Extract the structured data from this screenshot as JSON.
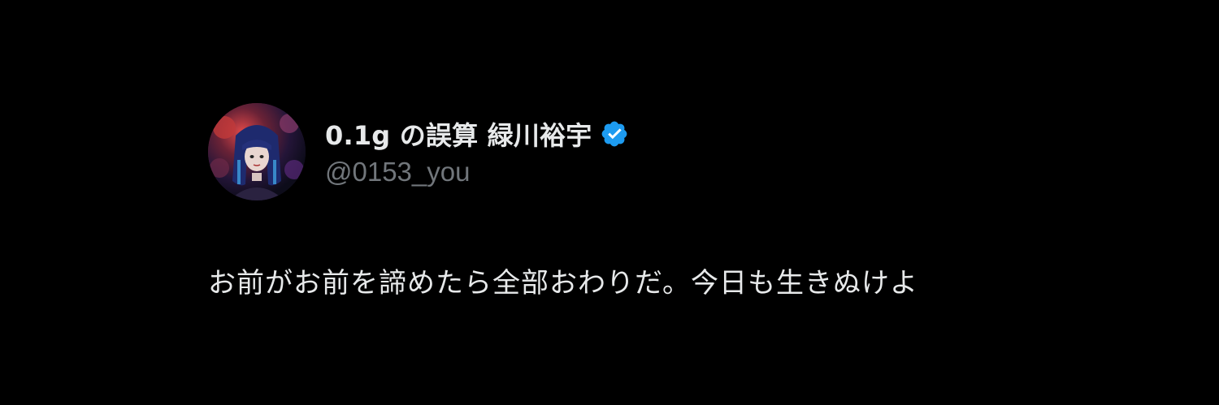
{
  "tweet": {
    "display_name": "0.1g の誤算 緑川裕宇",
    "handle": "@0153_you",
    "text": "お前がお前を諦めたら全部おわりだ。今日も生きぬけよ",
    "verified_icon": "verified-badge-icon",
    "avatar_icon": "profile-photo"
  },
  "colors": {
    "background": "#000000",
    "primary_text": "#e7e9ea",
    "secondary_text": "#71767b",
    "verified_blue": "#1d9bf0"
  }
}
